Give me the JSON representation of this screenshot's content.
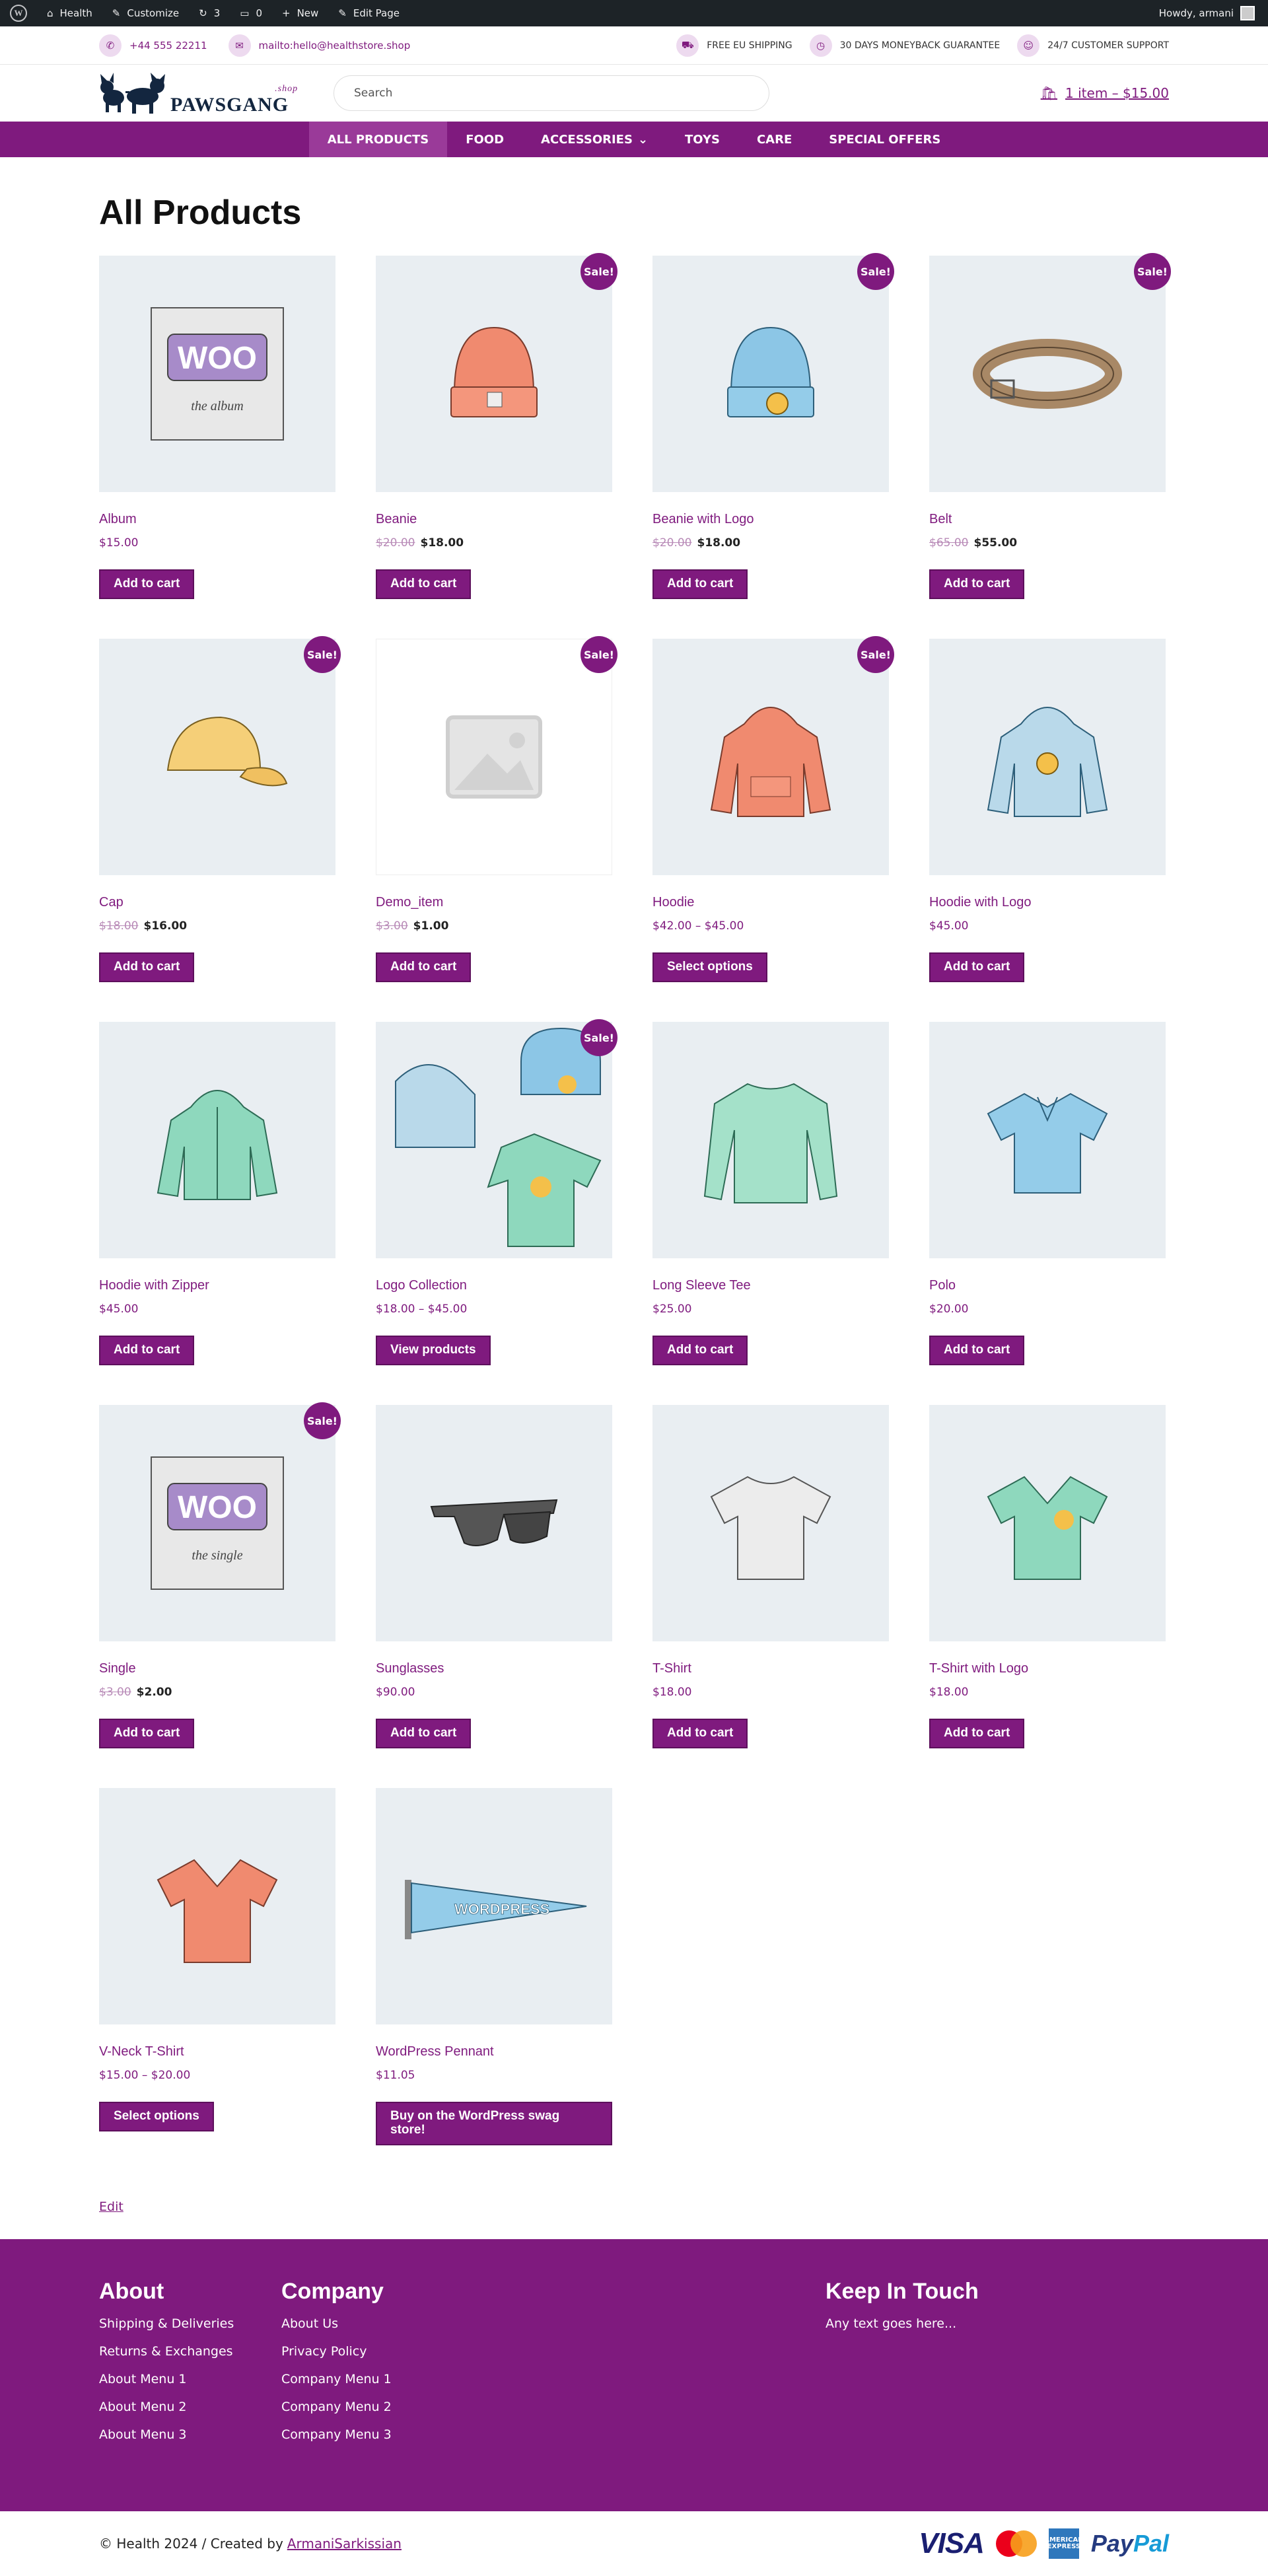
{
  "admin_bar": {
    "site_name": "Health",
    "customize": "Customize",
    "updates": "3",
    "comments": "0",
    "new": "New",
    "edit_page": "Edit Page",
    "howdy": "Howdy, armani"
  },
  "top_strip": {
    "phone": "+44 555 22211",
    "email": "mailto:hello@healthstore.shop",
    "shipping": "FREE EU SHIPPING",
    "guarantee": "30 DAYS MONEYBACK GUARANTEE",
    "support": "24/7 CUSTOMER SUPPORT"
  },
  "header": {
    "logo_text": "PAWSGANG",
    "logo_suffix": ".shop",
    "search_placeholder": "Search",
    "cart": "1 item – $15.00"
  },
  "nav": [
    {
      "label": "ALL PRODUCTS",
      "active": true
    },
    {
      "label": "FOOD"
    },
    {
      "label": "ACCESSORIES"
    },
    {
      "label": "TOYS"
    },
    {
      "label": "CARE"
    },
    {
      "label": "SPECIAL OFFERS"
    }
  ],
  "main": {
    "title": "All Products",
    "sale_badge": "Sale!",
    "products": [
      {
        "name": "Album",
        "price": "$15.00",
        "button": "Add to cart"
      },
      {
        "name": "Beanie",
        "old_price": "$20.00",
        "price": "$18.00",
        "sale": true,
        "button": "Add to cart"
      },
      {
        "name": "Beanie with Logo",
        "old_price": "$20.00",
        "price": "$18.00",
        "sale": true,
        "button": "Add to cart"
      },
      {
        "name": "Belt",
        "old_price": "$65.00",
        "price": "$55.00",
        "sale": true,
        "button": "Add to cart"
      },
      {
        "name": "Cap",
        "old_price": "$18.00",
        "price": "$16.00",
        "sale": true,
        "button": "Add to cart"
      },
      {
        "name": "Demo_item",
        "old_price": "$3.00",
        "price": "$1.00",
        "sale": true,
        "button": "Add to cart"
      },
      {
        "name": "Hoodie",
        "price": "$42.00 – $45.00",
        "sale": true,
        "button": "Select options"
      },
      {
        "name": "Hoodie with Logo",
        "price": "$45.00",
        "button": "Add to cart"
      },
      {
        "name": "Hoodie with Zipper",
        "price": "$45.00",
        "button": "Add to cart"
      },
      {
        "name": "Logo Collection",
        "price": "$18.00 – $45.00",
        "sale": true,
        "button": "View products"
      },
      {
        "name": "Long Sleeve Tee",
        "price": "$25.00",
        "button": "Add to cart"
      },
      {
        "name": "Polo",
        "price": "$20.00",
        "button": "Add to cart"
      },
      {
        "name": "Single",
        "old_price": "$3.00",
        "price": "$2.00",
        "sale": true,
        "button": "Add to cart"
      },
      {
        "name": "Sunglasses",
        "price": "$90.00",
        "button": "Add to cart"
      },
      {
        "name": "T-Shirt",
        "price": "$18.00",
        "button": "Add to cart"
      },
      {
        "name": "T-Shirt with Logo",
        "price": "$18.00",
        "button": "Add to cart"
      },
      {
        "name": "V-Neck T-Shirt",
        "price": "$15.00 – $20.00",
        "button": "Select options"
      },
      {
        "name": "WordPress Pennant",
        "price": "$11.05",
        "button": "Buy on the WordPress swag store!"
      }
    ],
    "edit_link": "Edit"
  },
  "footer": {
    "about": {
      "title": "About",
      "links": [
        "Shipping & Deliveries",
        "Returns & Exchanges",
        "About Menu 1",
        "About Menu 2",
        "About Menu 3"
      ]
    },
    "company": {
      "title": "Company",
      "links": [
        "About Us",
        "Privacy Policy",
        "Company Menu 1",
        "Company Menu 2",
        "Company Menu 3"
      ]
    },
    "keep_in_touch": {
      "title": "Keep In Touch",
      "text": "Any text goes here..."
    },
    "copyright": "© Health 2024 / Created by",
    "author": "ArmaniSarkissian",
    "payments": {
      "visa": "VISA",
      "mastercard": "mastercard",
      "amex": "AMERICAN EXPRESS",
      "paypal_1": "Pay",
      "paypal_2": "Pal"
    }
  },
  "colors": {
    "brand": "#7f1a7e",
    "admin_bar": "#1d2327",
    "product_bg": "#e9eef2"
  }
}
